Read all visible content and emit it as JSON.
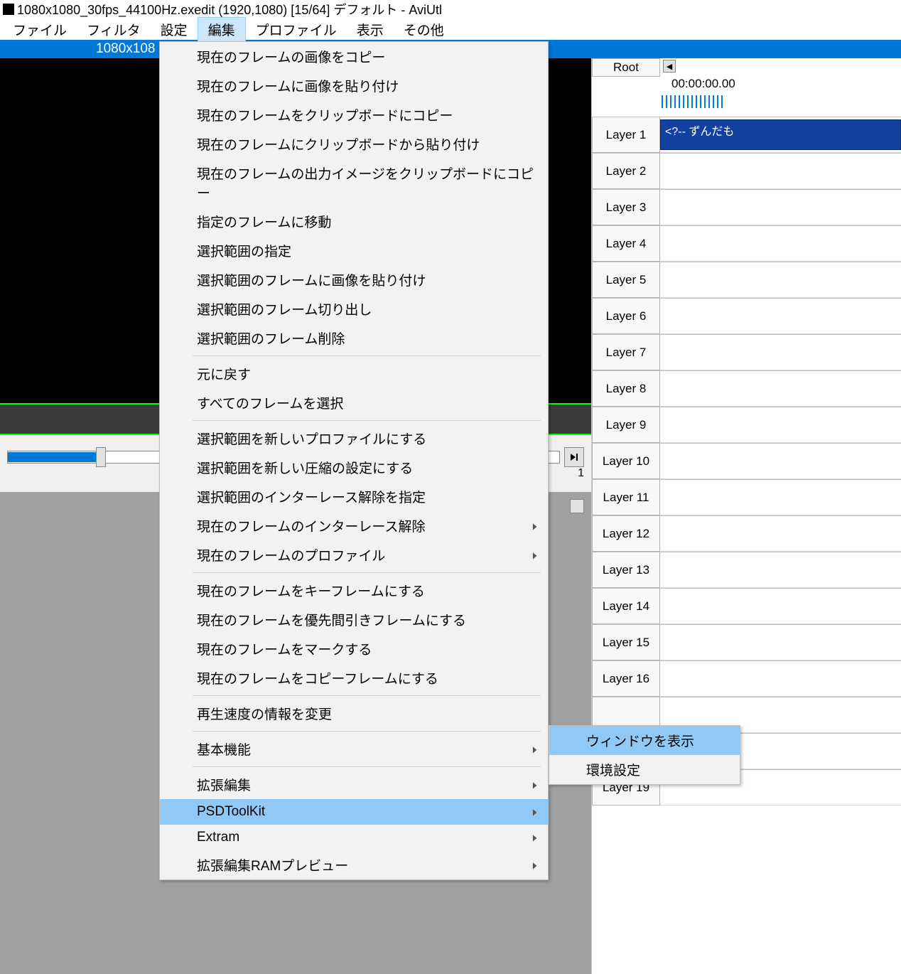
{
  "title": "1080x1080_30fps_44100Hz.exedit (1920,1080)  [15/64]  デフォルト - AviUtl",
  "menubar": {
    "file": "ファイル",
    "filter": "フィルタ",
    "settings": "設定",
    "edit": "編集",
    "profile": "プロファイル",
    "view": "表示",
    "other": "その他"
  },
  "blue_strip": "1080x108",
  "seek": {
    "label": "1"
  },
  "ctx": {
    "items": [
      {
        "k": "copy_frame_img",
        "label": "現在のフレームの画像をコピー"
      },
      {
        "k": "paste_img_frame",
        "label": "現在のフレームに画像を貼り付け"
      },
      {
        "k": "copy_frame_clip",
        "label": "現在のフレームをクリップボードにコピー"
      },
      {
        "k": "paste_clip_frame",
        "label": "現在のフレームにクリップボードから貼り付け"
      },
      {
        "k": "copy_out_img",
        "label": "現在のフレームの出力イメージをクリップボードにコピー"
      },
      {
        "k": "goto_frame",
        "label": "指定のフレームに移動"
      },
      {
        "k": "sel_range",
        "label": "選択範囲の指定"
      },
      {
        "k": "paste_sel_range",
        "label": "選択範囲のフレームに画像を貼り付け"
      },
      {
        "k": "cut_sel_range",
        "label": "選択範囲のフレーム切り出し"
      },
      {
        "k": "del_sel_range",
        "label": "選択範囲のフレーム削除"
      },
      {
        "sep": true
      },
      {
        "k": "undo",
        "label": "元に戻す"
      },
      {
        "k": "select_all",
        "label": "すべてのフレームを選択"
      },
      {
        "sep": true
      },
      {
        "k": "sel_new_profile",
        "label": "選択範囲を新しいプロファイルにする"
      },
      {
        "k": "sel_new_compress",
        "label": "選択範囲を新しい圧縮の設定にする"
      },
      {
        "k": "sel_interlace_set",
        "label": "選択範囲のインターレース解除を指定"
      },
      {
        "k": "cur_interlace",
        "label": "現在のフレームのインターレース解除",
        "sub": true
      },
      {
        "k": "cur_profile",
        "label": "現在のフレームのプロファイル",
        "sub": true
      },
      {
        "sep": true
      },
      {
        "k": "keyframe",
        "label": "現在のフレームをキーフレームにする"
      },
      {
        "k": "priority_frame",
        "label": "現在のフレームを優先間引きフレームにする"
      },
      {
        "k": "mark_frame",
        "label": "現在のフレームをマークする"
      },
      {
        "k": "copy_frame",
        "label": "現在のフレームをコピーフレームにする"
      },
      {
        "sep": true
      },
      {
        "k": "playback_info",
        "label": "再生速度の情報を変更"
      },
      {
        "sep": true
      },
      {
        "k": "basic",
        "label": "基本機能",
        "sub": true
      },
      {
        "sep": true
      },
      {
        "k": "exedit",
        "label": "拡張編集",
        "sub": true
      },
      {
        "k": "psdtoolkit",
        "label": "PSDToolKit",
        "sub": true,
        "hl": true
      },
      {
        "k": "extram",
        "label": "Extram",
        "sub": true
      },
      {
        "k": "rampreview",
        "label": "拡張編集RAMプレビュー",
        "sub": true
      }
    ]
  },
  "submenu": {
    "show_window": "ウィンドウを表示",
    "env_settings": "環境設定"
  },
  "timeline": {
    "root": "Root",
    "time": "00:00:00.00",
    "clip1": "<?-- ずんだも",
    "layers": [
      "Layer  1",
      "Layer  2",
      "Layer  3",
      "Layer  4",
      "Layer  5",
      "Layer  6",
      "Layer  7",
      "Layer  8",
      "Layer  9",
      "Layer 10",
      "Layer 11",
      "Layer 12",
      "Layer 13",
      "Layer 14",
      "Layer 15",
      "Layer 16",
      "",
      "",
      "Layer 19"
    ]
  }
}
